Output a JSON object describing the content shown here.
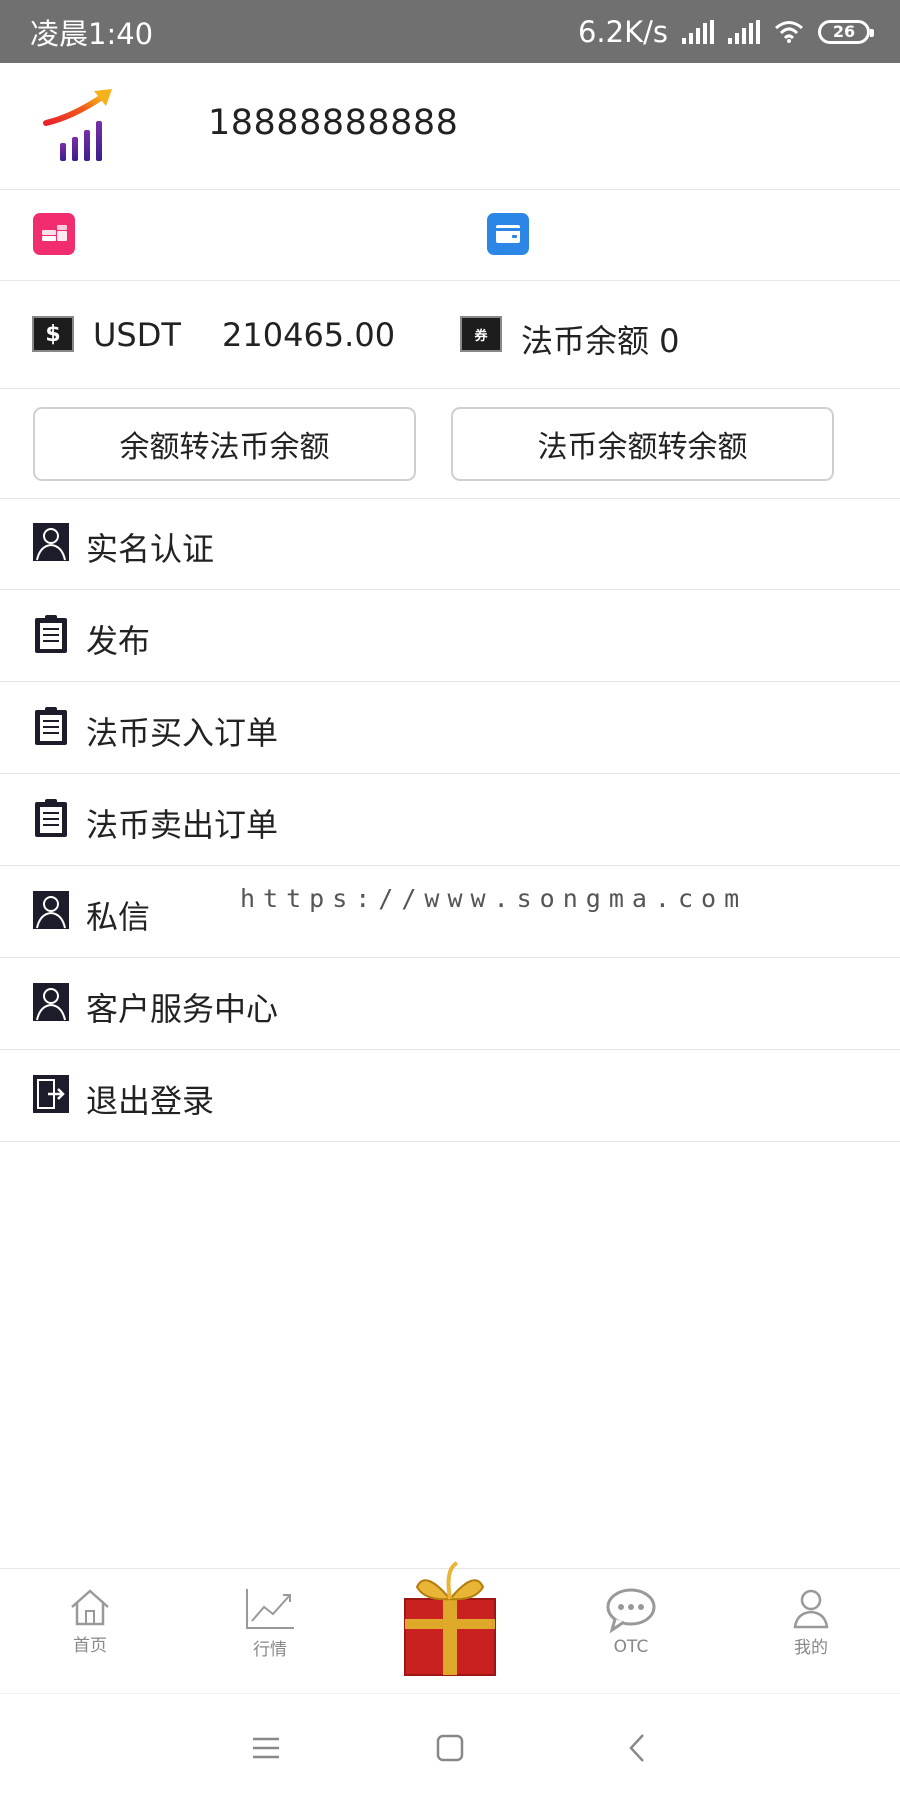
{
  "status_bar": {
    "time": "凌晨1:40",
    "network_speed": "6.2K/s",
    "battery_level": "26"
  },
  "profile": {
    "phone": "18888888888"
  },
  "quick_icons": [
    {
      "name": "assets-icon",
      "color": "#f22d6f"
    },
    {
      "name": "wallet-icon",
      "color": "#2b86e6"
    }
  ],
  "balance": {
    "usdt_label": "USDT",
    "usdt_value": "210465.00",
    "fiat_label": "法币余额 0",
    "usd_icon_glyph": "$",
    "fiat_icon_glyph": "券"
  },
  "transfer": {
    "to_fiat_label": "余额转法币余额",
    "from_fiat_label": "法币余额转余额"
  },
  "menu": {
    "items": [
      {
        "label": "实名认证",
        "icon": "user-icon"
      },
      {
        "label": "发布",
        "icon": "clipboard-icon"
      },
      {
        "label": "法币买入订单",
        "icon": "clipboard-icon"
      },
      {
        "label": "法币卖出订单",
        "icon": "clipboard-icon"
      },
      {
        "label": "私信",
        "icon": "user-icon"
      },
      {
        "label": "客户服务中心",
        "icon": "user-icon"
      },
      {
        "label": "退出登录",
        "icon": "logout-icon"
      }
    ]
  },
  "watermark": "https://www.songma.com",
  "tabbar": {
    "home": "首页",
    "market": "行情",
    "otc": "OTC",
    "mine": "我的"
  },
  "colors": {
    "status_bar": "#707070",
    "pink_accent": "#f22d6f",
    "blue_accent": "#2b86e6",
    "tab_inactive": "#888888"
  }
}
